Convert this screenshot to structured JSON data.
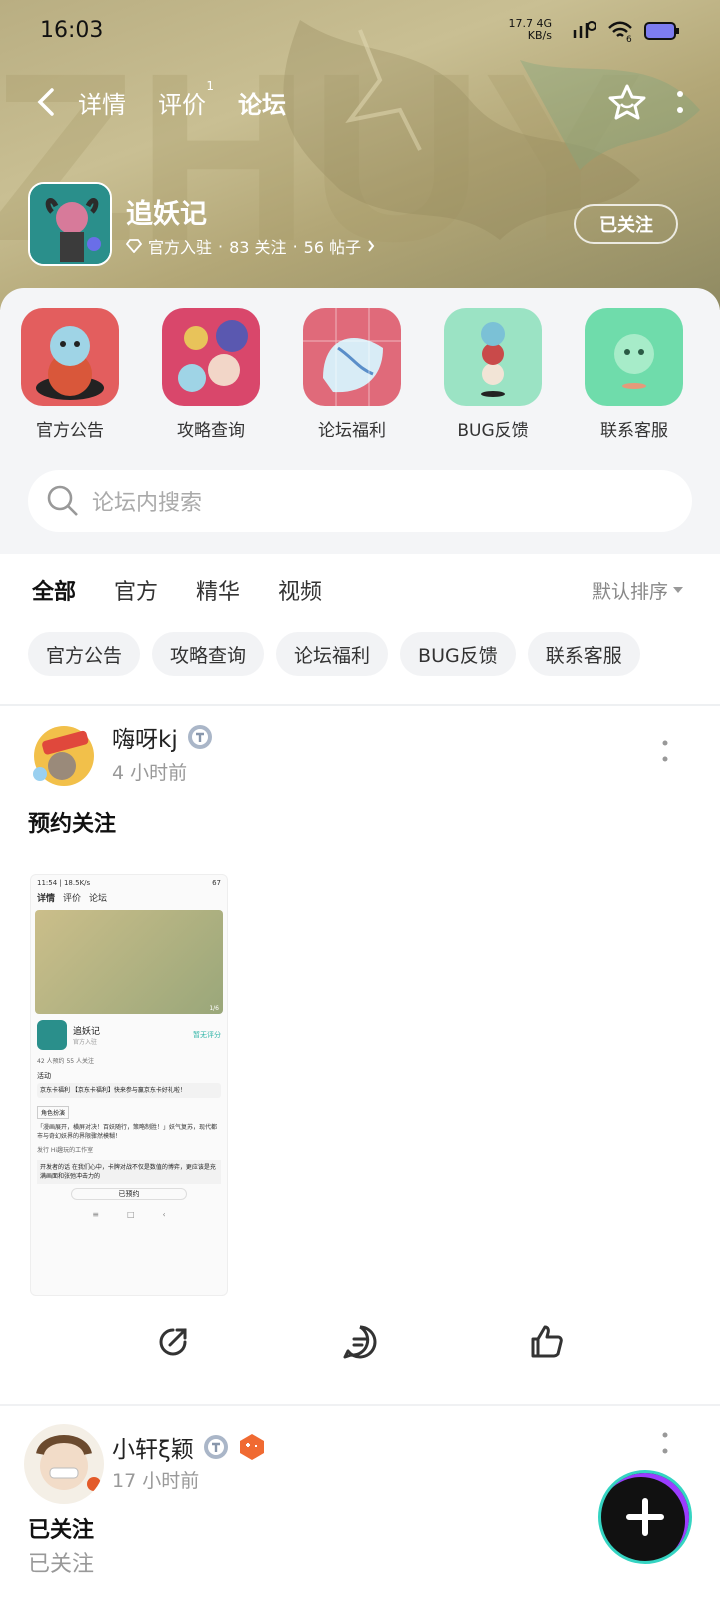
{
  "status_bar": {
    "time": "16:03",
    "net_speed": "17.7",
    "net_unit": "KB/s",
    "signal_label": "4G",
    "sim_index": "6"
  },
  "nav": {
    "tabs": [
      {
        "label": "详情",
        "badge": ""
      },
      {
        "label": "评价",
        "badge": "1"
      },
      {
        "label": "论坛",
        "badge": ""
      }
    ]
  },
  "game": {
    "name": "追妖记",
    "official_label": "官方入驻",
    "followers": "83 关注",
    "posts": "56 帖子",
    "separator": "·",
    "follow_button": "已关注"
  },
  "quick_entries": [
    {
      "label": "官方公告",
      "color": "#e05a5a"
    },
    {
      "label": "攻略查询",
      "color": "#d94a6a"
    },
    {
      "label": "论坛福利",
      "color": "#e46a7a"
    },
    {
      "label": "BUG反馈",
      "color": "#7ed8b8"
    },
    {
      "label": "联系客服",
      "color": "#62d8a6"
    }
  ],
  "search": {
    "placeholder": "论坛内搜索"
  },
  "filter_tabs": [
    "全部",
    "官方",
    "精华",
    "视频"
  ],
  "sort_label": "默认排序",
  "chips": [
    "官方公告",
    "攻略查询",
    "论坛福利",
    "BUG反馈",
    "联系客服"
  ],
  "posts": [
    {
      "author": "嗨呀kj",
      "time": "4 小时前",
      "title": "预约关注",
      "screenshot": {
        "status": "11:54 | 18.5K/s",
        "battery": "67",
        "tabs": [
          "详情",
          "评价",
          "论坛"
        ],
        "game_name": "追妖记",
        "official": "官方入驻",
        "rating": "暂无评分",
        "stats": "42 人预约   55 人关注",
        "activity": "活动",
        "tag": "角色扮演",
        "button": "已预约",
        "page_indicator": "1/6",
        "banner_text": "京东卡福利 【京东卡福利】快来参与赢京东卡好礼啦！",
        "desc": "「漫画展开，横屏对决！百妖随行，策略制胜！」妖气复苏，现代都市与奇幻妖界的界限骤然模糊！",
        "publisher": "发行  Hi趣玩的工作室",
        "dev_note": "开发者的话  在我们心中，卡牌对战不仅是数值的博弈，更应该是充满画面和张弛冲击力的"
      }
    },
    {
      "author": "小轩ξ颖",
      "time": "17 小时前",
      "title": "已关注",
      "subtitle": "已关注"
    }
  ],
  "colors": {
    "accent": "#33d4c1",
    "header": "#b9ae82"
  }
}
